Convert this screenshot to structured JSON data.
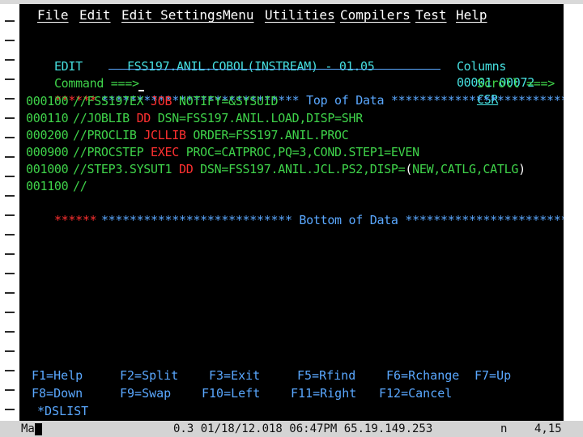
{
  "menubar": {
    "items": [
      "File",
      "Edit",
      "Edit_Settings",
      "Menu",
      "Utilities",
      "Compilers",
      "Test",
      "Help"
    ]
  },
  "header": {
    "mode": "EDIT",
    "dataset": "FSS197.ANIL.COBOL(INSTREAM) - 01.05",
    "columns_label": "Columns",
    "columns_value": "00001 00072",
    "command_label": "Command ===>",
    "command_value": "",
    "scroll_label": "Scroll ===>",
    "scroll_value": "CSR"
  },
  "editor": {
    "top_marker": "******",
    "top_text": "**************************** Top of Data ******************************",
    "lines": [
      {
        "num": "000100",
        "parts": [
          [
            "//FSS197EX ",
            "green"
          ],
          [
            "JOB",
            "red"
          ],
          [
            " NOTIFY=&SYSUID",
            "green"
          ]
        ]
      },
      {
        "num": "000110",
        "parts": [
          [
            "//JOBLIB ",
            "green"
          ],
          [
            "DD",
            "red"
          ],
          [
            " DSN=FSS197.ANIL.LOAD,DISP=SHR",
            "green"
          ]
        ]
      },
      {
        "num": "000200",
        "parts": [
          [
            "//PROCLIB ",
            "green"
          ],
          [
            "JCLLIB",
            "red"
          ],
          [
            " ORDER=FSS197.ANIL.PROC",
            "green"
          ]
        ]
      },
      {
        "num": "000900",
        "parts": [
          [
            "//PROCSTEP ",
            "green"
          ],
          [
            "EXEC",
            "red"
          ],
          [
            " PROC=CATPROC,PQ=3,COND.STEP1=EVEN",
            "green"
          ]
        ]
      },
      {
        "num": "001000",
        "parts": [
          [
            "//STEP3.SYSUT1 ",
            "green"
          ],
          [
            "DD",
            "red"
          ],
          [
            " DSN=FSS197.ANIL.JCL.PS2,DISP=",
            "green"
          ],
          [
            "(",
            "white"
          ],
          [
            "NEW,CATLG,CATLG",
            "green"
          ],
          [
            ")",
            "white"
          ]
        ]
      },
      {
        "num": "001100",
        "parts": [
          [
            "//",
            "green"
          ]
        ]
      }
    ],
    "bottom_marker": "******",
    "bottom_text": "*************************** Bottom of Data ****************************"
  },
  "pfkeys": {
    "row1": [
      "F1=Help",
      "F2=Split",
      "F3=Exit",
      "F5=Rfind",
      "F6=Rchange",
      "F7=Up"
    ],
    "row2": [
      "F8=Down",
      "F9=Swap",
      "F10=Left",
      "F11=Right",
      "F12=Cancel"
    ],
    "dslist": "*DSLIST"
  },
  "statusbar": {
    "session": "Ma",
    "info": "0.3 01/18/12.018 06:47PM 65.19.149.253",
    "indicator": "n",
    "position": "4,15"
  },
  "colors": {
    "screen_bg": "#000000",
    "green": "#3fd34a",
    "blue": "#5aa8ff",
    "red": "#ff3030",
    "white": "#ffffff",
    "turquoise": "#46e0e0"
  }
}
